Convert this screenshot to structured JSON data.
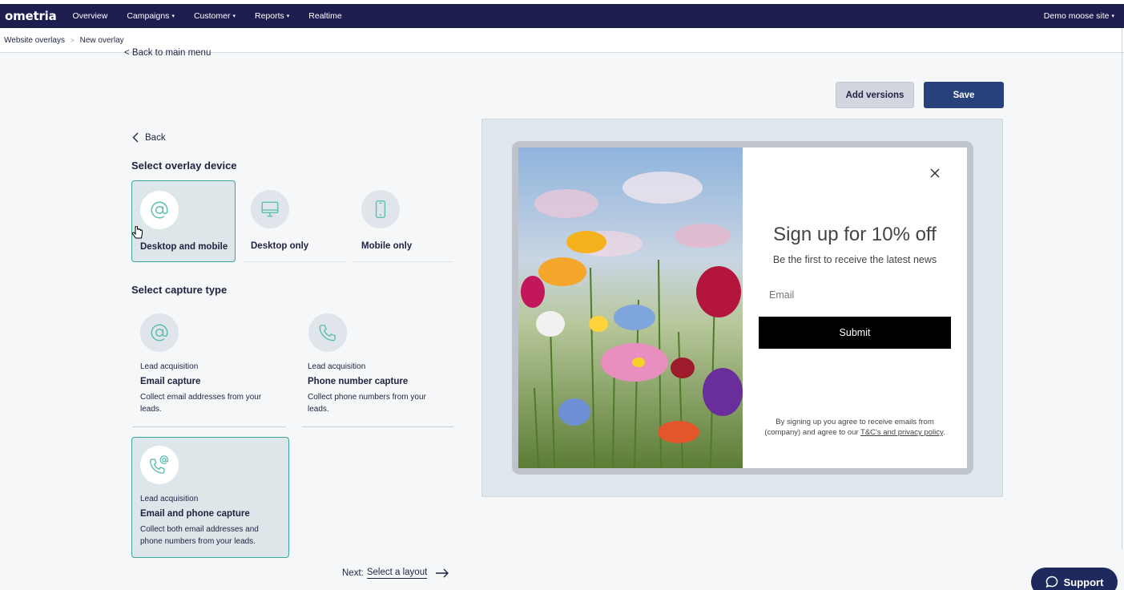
{
  "nav": {
    "logo": "ometria",
    "items": [
      {
        "label": "Overview",
        "dropdown": false
      },
      {
        "label": "Campaigns",
        "dropdown": true
      },
      {
        "label": "Customer",
        "dropdown": true
      },
      {
        "label": "Reports",
        "dropdown": true
      },
      {
        "label": "Realtime",
        "dropdown": false
      }
    ],
    "site": "Demo moose site"
  },
  "breadcrumb": {
    "parent": "Website overlays",
    "current": "New overlay",
    "separator": ">"
  },
  "back_to_main": "< Back to main menu",
  "toolbar": {
    "add_versions": "Add versions",
    "save": "Save"
  },
  "back": "Back",
  "device": {
    "title": "Select overlay device",
    "options": [
      {
        "label": "Desktop and mobile",
        "icon": "at-icon",
        "selected": true
      },
      {
        "label": "Desktop only",
        "icon": "monitor-icon",
        "selected": false
      },
      {
        "label": "Mobile only",
        "icon": "phone-device-icon",
        "selected": false
      }
    ]
  },
  "capture": {
    "title": "Select capture type",
    "options": [
      {
        "kicker": "Lead acquisition",
        "title": "Email capture",
        "desc": "Collect email addresses from your leads.",
        "icon": "at-icon",
        "selected": false
      },
      {
        "kicker": "Lead acquisition",
        "title": "Phone number capture",
        "desc": "Collect phone numbers from your leads.",
        "icon": "phone-icon",
        "selected": false
      },
      {
        "kicker": "Lead acquisition",
        "title": "Email and phone capture",
        "desc": "Collect both email addresses and phone numbers from your leads.",
        "icon": "phone-at-icon",
        "selected": true
      }
    ]
  },
  "next": {
    "prefix": "Next:",
    "link": "Select a layout"
  },
  "preview": {
    "title": "Sign up for 10% off",
    "subtitle": "Be the first to receive the latest news",
    "email_placeholder": "Email",
    "submit": "Submit",
    "terms_prefix": "By signing up you agree to receive emails from (company) and agree to our ",
    "terms_link": "T&C's and privacy policy",
    "terms_suffix": "."
  },
  "support": "Support",
  "colors": {
    "nav_bg": "#1e1d4f",
    "accent": "#3aa79a",
    "save_bg": "#27417a",
    "selected_bg": "#dde7ea"
  }
}
